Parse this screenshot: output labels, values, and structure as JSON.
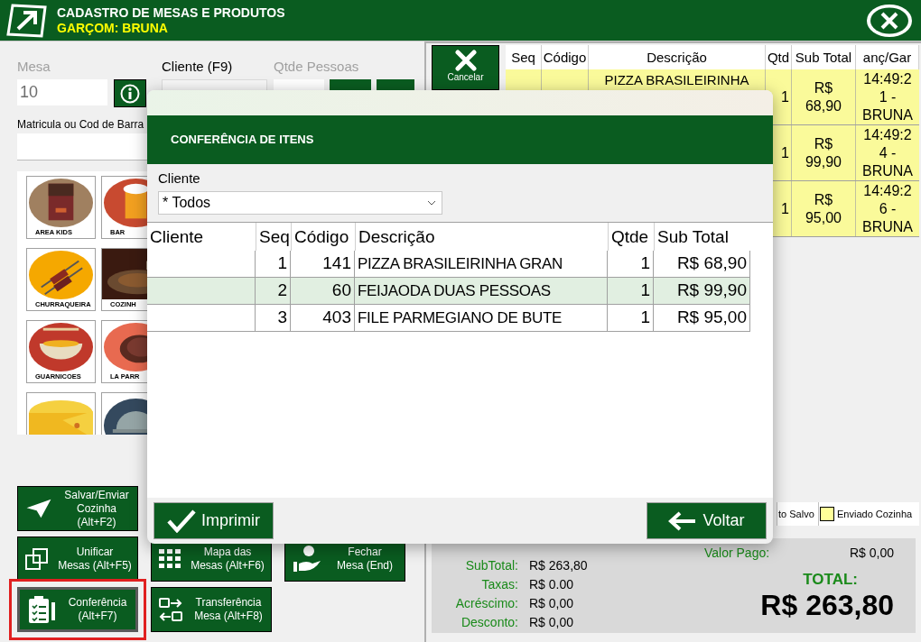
{
  "header": {
    "title": "CADASTRO DE MESAS E PRODUTOS",
    "waiter": "GARÇOM: BRUNA"
  },
  "form": {
    "mesa": {
      "label": "Mesa",
      "value": "10",
      "disabled": true
    },
    "cliente": {
      "label": "Cliente (F9)",
      "disabled": false
    },
    "pessoas": {
      "label": "Qtde Pessoas",
      "disabled": true
    },
    "matricula": {
      "label": "Matricula ou Cod de Barra"
    }
  },
  "categories": [
    {
      "kind": "chocolate",
      "label": "AREA KIDS"
    },
    {
      "kind": "beer",
      "label": "BAR"
    },
    {
      "kind": "skewer",
      "label": "CHURRAQUEIRA"
    },
    {
      "label": "COZINH"
    },
    {
      "kind": "noodles",
      "label": "GUARNICOES"
    },
    {
      "kind": "steak",
      "label": "LA PARR"
    },
    {
      "kind": "cheese"
    },
    {
      "kind": "cloche"
    }
  ],
  "actions": [
    [
      {
        "kind": "send",
        "lines": [
          "Salvar/Enviar",
          "Cozinha (Alt+F2)"
        ],
        "highlighted": false
      }
    ],
    [
      {
        "kind": "merge",
        "lines": [
          "Unificar",
          "Mesas (Alt+F5)"
        ],
        "highlighted": false
      },
      {
        "kind": "grid",
        "lines": [
          "Mapa das",
          "Mesas (Alt+F6)"
        ],
        "highlighted": false
      },
      {
        "kind": "pay",
        "lines": [
          "Fechar",
          "Mesa (End)"
        ],
        "highlighted": false
      }
    ],
    [
      {
        "kind": "clipboard",
        "lines": [
          "Conferência",
          "(Alt+F7)"
        ],
        "highlighted": true
      },
      {
        "kind": "transfer",
        "lines": [
          "Transferência",
          "Mesa (Alt+F8)"
        ],
        "highlighted": false
      }
    ]
  ],
  "cancel_button": "Cancelar",
  "items_table": {
    "columns": [
      "Seq",
      "Código",
      "Descrição",
      "Qtd",
      "Sub Total",
      "anç/Gar"
    ],
    "rows": [
      {
        "description": "PIZZA BRASILEIRINHA",
        "qtde": "1",
        "subtotal": "R$ 68,90",
        "time": "14:49:21 - BRUNA"
      },
      {
        "qtde": "1",
        "subtotal": "R$ 99,90",
        "time": "14:49:24 - BRUNA"
      },
      {
        "qtde": "1",
        "subtotal": "R$ 95,00",
        "time": "14:49:26 - BRUNA"
      }
    ]
  },
  "legend": [
    {
      "label": "to Salvo"
    },
    {
      "label": "Enviado Cozinha",
      "color": "#ffff99"
    }
  ],
  "summary": {
    "rows": [
      {
        "label": "SubTotal:",
        "value": "R$ 263,80"
      },
      {
        "label": "Taxas:",
        "value": "R$ 0.00"
      },
      {
        "label": "Acréscimo:",
        "value": "R$ 0,00"
      },
      {
        "label": "Desconto:",
        "value": "R$ 0,00"
      }
    ],
    "paid_label": "Valor Pago:",
    "paid_value": "R$ 0,00",
    "total_label": "TOTAL:",
    "total_value": "R$ 263,80"
  },
  "dialog": {
    "title": "CONFERÊNCIA DE ITENS",
    "cliente_label": "Cliente",
    "cliente_value": "* Todos",
    "table": {
      "columns": [
        "Cliente",
        "Seq",
        "Código",
        "Descrição",
        "Qtde",
        "Sub Total"
      ],
      "rows": [
        {
          "seq": "1",
          "codigo": "141",
          "descricao": "PIZZA BRASILEIRINHA GRAN",
          "qtde": "1",
          "subtotal": "R$ 68,90",
          "selected": false
        },
        {
          "seq": "2",
          "codigo": "60",
          "descricao": "FEIJAODA DUAS PESSOAS",
          "qtde": "1",
          "subtotal": "R$ 99,90",
          "selected": true
        },
        {
          "seq": "3",
          "codigo": "403",
          "descricao": "FILE PARMEGIANO DE BUTE",
          "qtde": "1",
          "subtotal": "R$ 95,00",
          "selected": false
        }
      ]
    },
    "buttons": [
      {
        "kind": "confirm",
        "label": "Imprimir"
      },
      {
        "kind": "back",
        "label": "Voltar"
      }
    ]
  }
}
